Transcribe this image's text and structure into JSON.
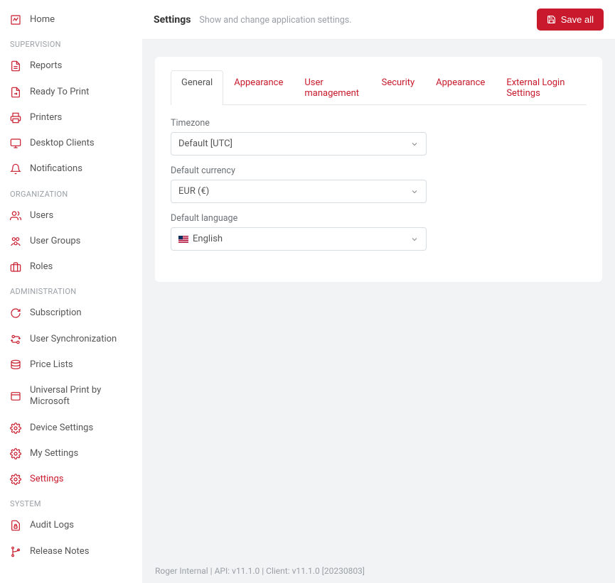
{
  "header": {
    "title": "Settings",
    "subtitle": "Show and change application settings.",
    "save_label": "Save all"
  },
  "sidebar": {
    "items": [
      {
        "label": "Home",
        "icon": "chart-icon"
      }
    ],
    "supervision_header": "SUPERVISION",
    "supervision": [
      {
        "label": "Reports",
        "icon": "file-icon"
      },
      {
        "label": "Ready To Print",
        "icon": "file-send-icon"
      },
      {
        "label": "Printers",
        "icon": "printer-icon"
      },
      {
        "label": "Desktop Clients",
        "icon": "desktop-icon"
      },
      {
        "label": "Notifications",
        "icon": "bell-icon"
      }
    ],
    "organization_header": "ORGANIZATION",
    "organization": [
      {
        "label": "Users",
        "icon": "users-icon"
      },
      {
        "label": "User Groups",
        "icon": "user-groups-icon"
      },
      {
        "label": "Roles",
        "icon": "briefcase-icon"
      }
    ],
    "administration_header": "ADMINISTRATION",
    "administration": [
      {
        "label": "Subscription",
        "icon": "refresh-icon"
      },
      {
        "label": "User Synchronization",
        "icon": "sync-users-icon"
      },
      {
        "label": "Price Lists",
        "icon": "stack-icon"
      },
      {
        "label": "Universal Print by Microsoft",
        "icon": "window-icon"
      },
      {
        "label": "Device Settings",
        "icon": "gear-icon"
      },
      {
        "label": "My Settings",
        "icon": "gear-icon"
      },
      {
        "label": "Settings",
        "icon": "gear-icon",
        "active": true
      }
    ],
    "system_header": "SYSTEM",
    "system": [
      {
        "label": "Audit Logs",
        "icon": "lock-file-icon"
      },
      {
        "label": "Release Notes",
        "icon": "branch-icon"
      }
    ]
  },
  "tabs": [
    {
      "label": "General",
      "active": true
    },
    {
      "label": "Appearance"
    },
    {
      "label": "User management"
    },
    {
      "label": "Security"
    },
    {
      "label": "Appearance"
    },
    {
      "label": "External Login Settings"
    }
  ],
  "form": {
    "timezone_label": "Timezone",
    "timezone_value": "Default [UTC]",
    "currency_label": "Default currency",
    "currency_value": "EUR (€)",
    "language_label": "Default language",
    "language_value": "English"
  },
  "footer": "Roger Internal | API: v11.1.0 | Client: v11.1.0 [20230803]",
  "colors": {
    "accent": "#c81a2c"
  }
}
